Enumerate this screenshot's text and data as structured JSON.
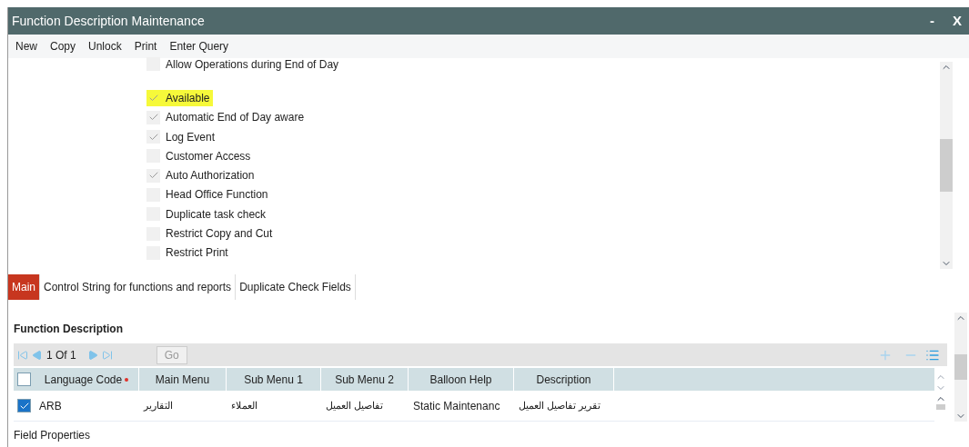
{
  "window": {
    "title": "Function Description Maintenance",
    "minimize": "-",
    "close": "X"
  },
  "toolbar": [
    "New",
    "Copy",
    "Unlock",
    "Print",
    "Enter Query"
  ],
  "options": [
    {
      "label": "Allow Operations during End of Day",
      "checked": false,
      "highlighted": false
    },
    {
      "label": "Available",
      "checked": true,
      "highlighted": true
    },
    {
      "label": "Automatic End of Day aware",
      "checked": true,
      "highlighted": false
    },
    {
      "label": "Log Event",
      "checked": true,
      "highlighted": false
    },
    {
      "label": "Customer Access",
      "checked": false,
      "highlighted": false
    },
    {
      "label": "Auto Authorization",
      "checked": true,
      "highlighted": false
    },
    {
      "label": "Head Office Function",
      "checked": false,
      "highlighted": false
    },
    {
      "label": "Duplicate task check",
      "checked": false,
      "highlighted": false
    },
    {
      "label": "Restrict Copy and Cut",
      "checked": false,
      "highlighted": false
    },
    {
      "label": "Restrict Print",
      "checked": false,
      "highlighted": false
    }
  ],
  "tabs": [
    {
      "label": "Main",
      "selected": true
    },
    {
      "label": "Control String for functions and reports",
      "selected": false
    },
    {
      "label": "Duplicate Check Fields",
      "selected": false
    }
  ],
  "section": {
    "title": "Function Description",
    "pager": {
      "text": "1 Of 1",
      "go": "Go"
    },
    "table": {
      "select_all": false,
      "columns": [
        {
          "label": "Language Code",
          "required": true
        },
        {
          "label": "Main Menu",
          "required": false
        },
        {
          "label": "Sub Menu 1",
          "required": false
        },
        {
          "label": "Sub Menu 2",
          "required": false
        },
        {
          "label": "Balloon Help",
          "required": false
        },
        {
          "label": "Description",
          "required": false
        }
      ],
      "rows": [
        {
          "checked": true,
          "cells": [
            "ARB",
            "التقارير",
            "العملاء",
            "تفاصيل العميل",
            "Static Maintenanc",
            "تقرير تفاصيل العميل"
          ]
        }
      ]
    }
  },
  "footer": "Field Properties"
}
